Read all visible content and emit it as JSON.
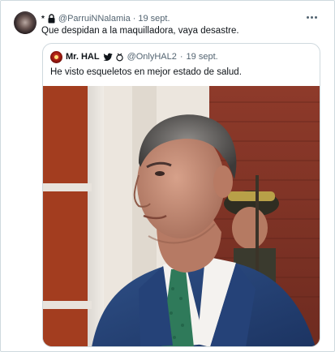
{
  "tweet": {
    "name_mark": "*",
    "handle": "@ParruiNNalamia",
    "separator": "·",
    "date": "19 sept.",
    "text": "Que despidan a la maquilladora, vaya desastre."
  },
  "quoted_tweet": {
    "name": "Mr. HAL",
    "handle": "@OnlyHAL2",
    "separator": "·",
    "date": "19 sept.",
    "text": "He visto esqueletos en mejor estado de salud."
  },
  "icons": {
    "lock": "lock-icon",
    "more": "more-horizontal-icon",
    "bird": "bird-icon",
    "emblem": "emblem-icon"
  },
  "colors": {
    "text": "#0f1419",
    "secondary": "#536471",
    "border": "#cfd9de"
  }
}
